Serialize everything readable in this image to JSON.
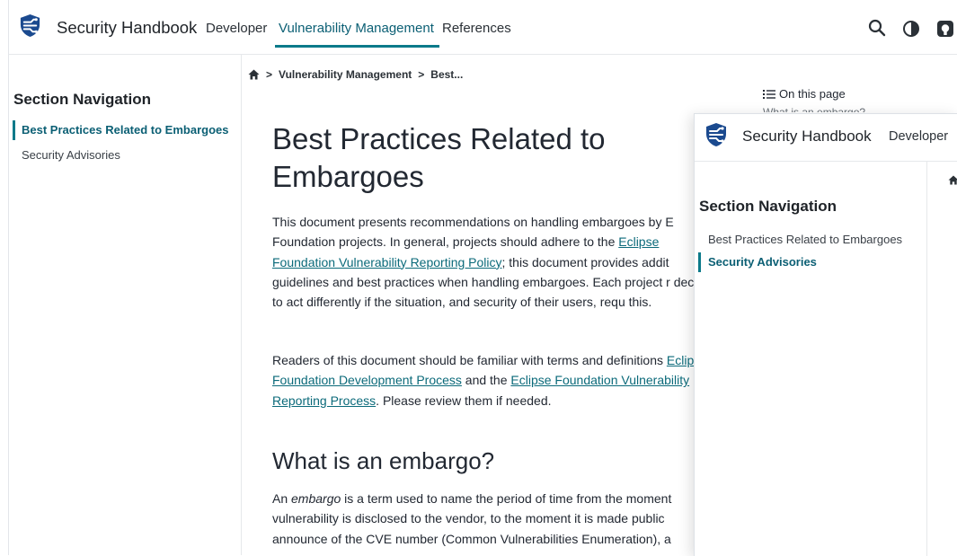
{
  "back": {
    "brand": "Security Handbook",
    "nav": [
      "Developer",
      "Vulnerability Management",
      "References"
    ],
    "sidebar": {
      "title": "Section Navigation",
      "items": [
        "Best Practices Related to Embargoes",
        "Security Advisories"
      ]
    },
    "breadcrumb": [
      "Vulnerability Management",
      "Best..."
    ],
    "title": "Best Practices Related to Embargoes",
    "p1": {
      "t1": "This document presents recommendations on handling embargoes by E Foundation projects. In general, projects should adhere to the ",
      "link1": "Eclipse Foundation Vulnerability Reporting Policy",
      "t2": "; this document provides addit guidelines and best practices when handling embargoes. Each project r decide to act differently if the situation, and security of their users, requ this."
    },
    "p2": {
      "t1": "Readers of this document should be familiar with terms and definitions ",
      "link1": "Eclipse Foundation Development Process",
      "t2": " and the ",
      "link2": "Eclipse Foundation Vulnerability Reporting Process",
      "t3": ". Please review them if needed."
    },
    "h2": "What is an embargo?",
    "p3": {
      "t1": "An ",
      "em": "embargo",
      "t2": " is a term used to name the period of time from the moment vulnerability is disclosed to the vendor, to the moment it is made public announce of the CVE number (Common Vulnerabilities Enumeration), a"
    },
    "toc": {
      "heading": "On this page",
      "first": "What is an embargo?"
    }
  },
  "front": {
    "brand": "Security Handbook",
    "nav": [
      "Developer"
    ],
    "sidebar": {
      "title": "Section Navigation",
      "items": [
        "Best Practices Related to Embargoes",
        "Security Advisories"
      ]
    }
  },
  "colors": {
    "accent": "#0b7a8a",
    "link": "#0b6a7a",
    "logo": "#1b4a8f"
  },
  "icons": [
    "logo-shield-icon",
    "search-icon",
    "theme-toggle-icon",
    "github-icon",
    "home-icon",
    "list-icon"
  ]
}
